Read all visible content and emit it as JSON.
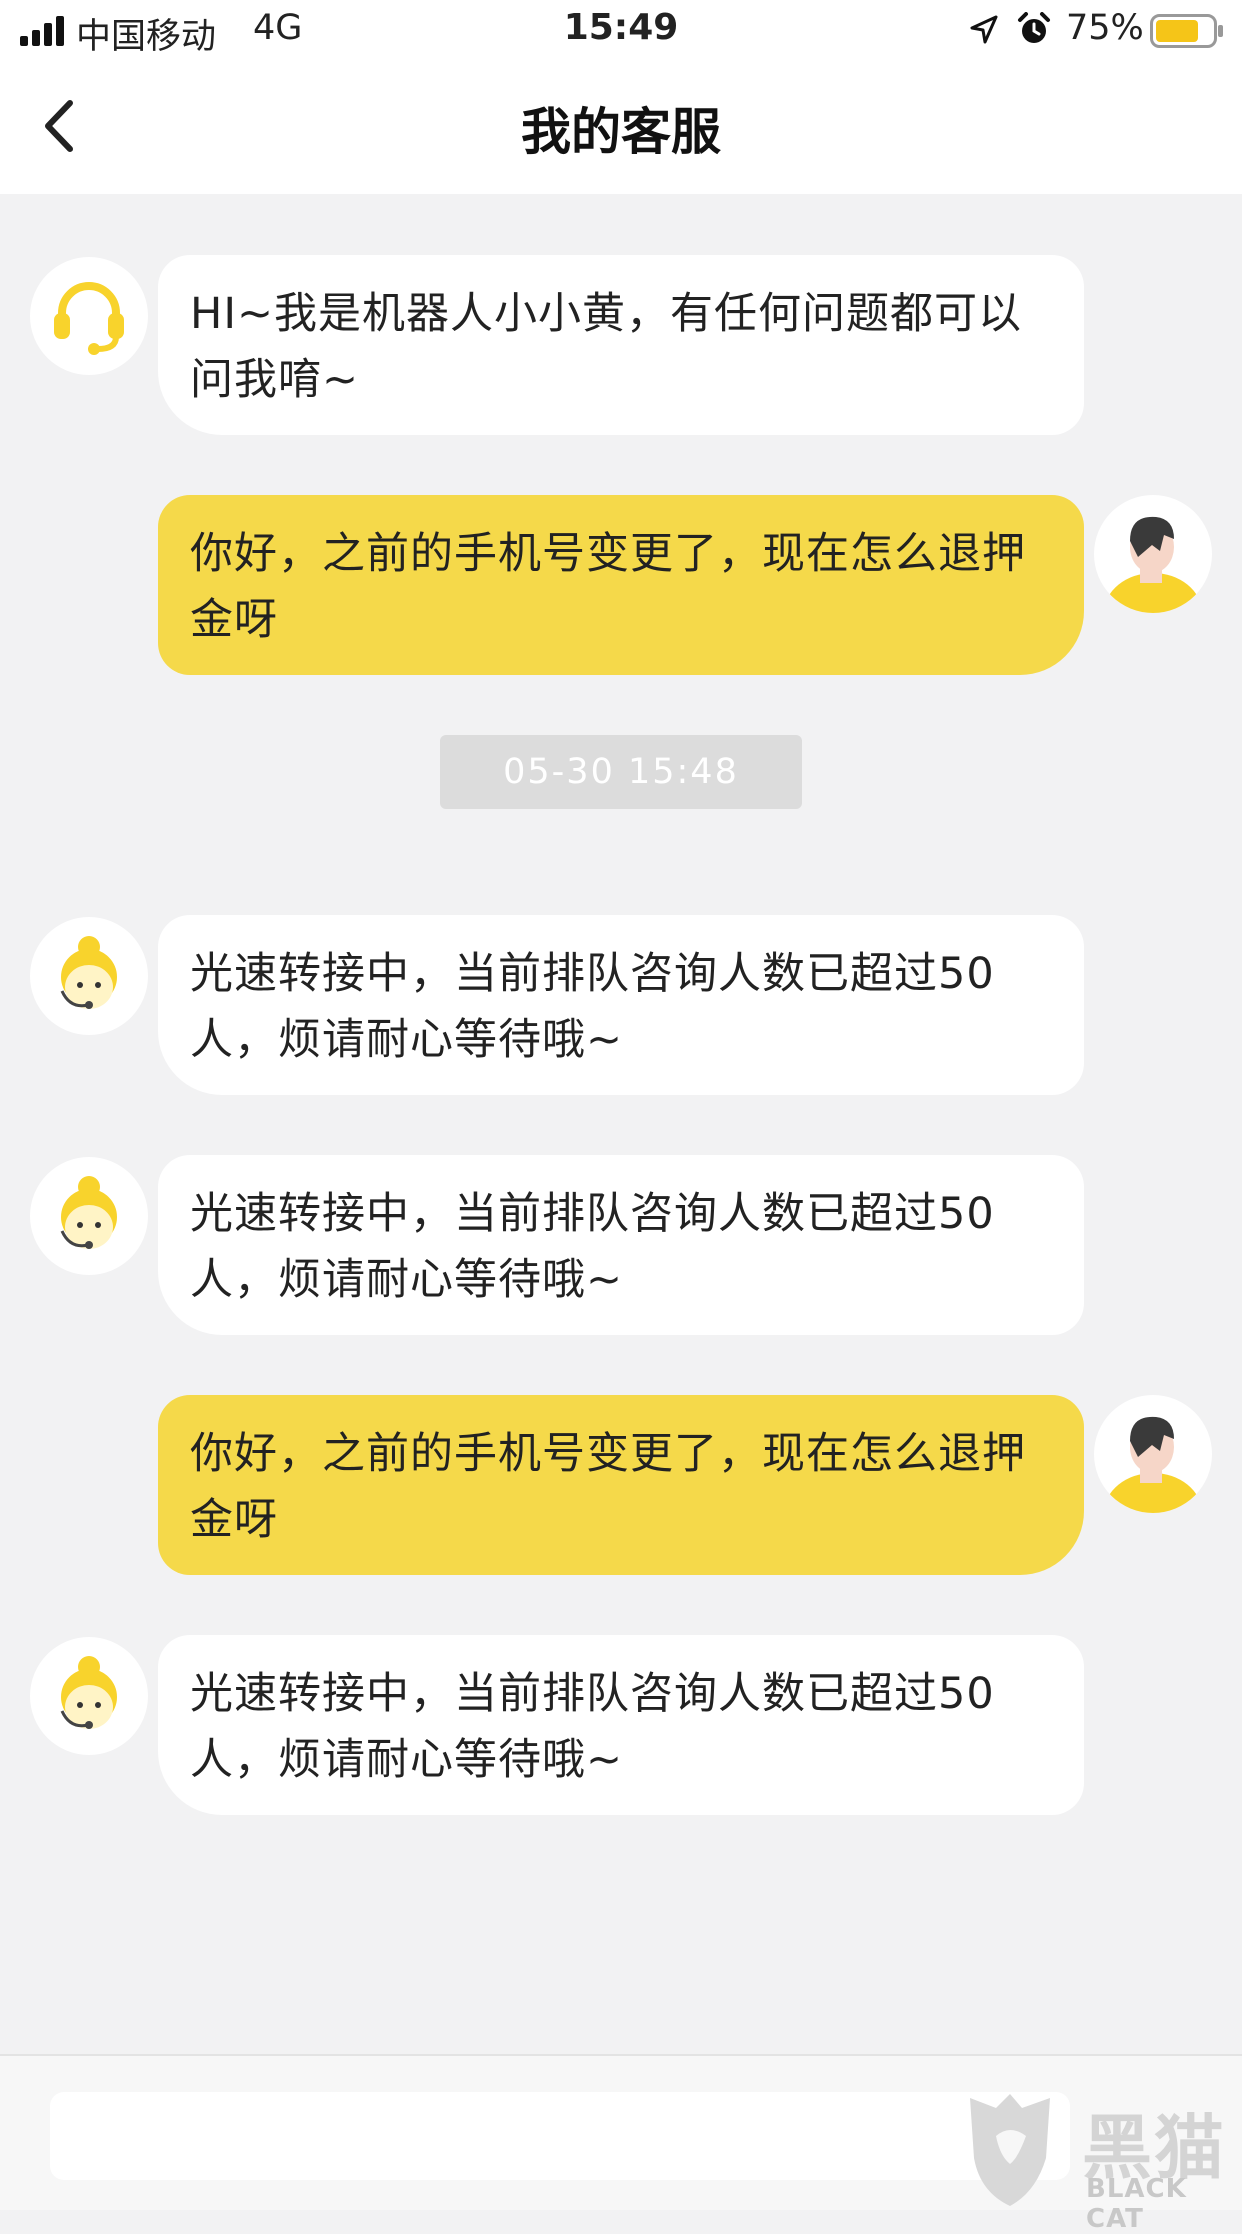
{
  "status_bar": {
    "carrier": "中国移动",
    "network": "4G",
    "time": "15:49",
    "battery": "75%",
    "battery_level": 0.75
  },
  "header": {
    "title": "我的客服"
  },
  "messages": [
    {
      "from": "bot",
      "avatar": "headset-icon",
      "text": "HI~我是机器人小小黄，有任何问题都可以问我唷~"
    },
    {
      "from": "user",
      "avatar": "user-avatar",
      "text": "你好，之前的手机号变更了，现在怎么退押金呀"
    },
    {
      "from": "system",
      "text": "05-30 15:48"
    },
    {
      "from": "agent",
      "avatar": "agent-avatar",
      "text": "光速转接中，当前排队咨询人数已超过50人，烦请耐心等待哦~"
    },
    {
      "from": "agent",
      "avatar": "agent-avatar",
      "text": "光速转接中，当前排队咨询人数已超过50人，烦请耐心等待哦~"
    },
    {
      "from": "user",
      "avatar": "user-avatar",
      "text": "你好，之前的手机号变更了，现在怎么退押金呀"
    },
    {
      "from": "agent",
      "avatar": "agent-avatar",
      "text": "光速转接中，当前排队咨询人数已超过50人，烦请耐心等待哦~"
    }
  ],
  "input": {
    "placeholder": ""
  },
  "watermark": {
    "text": "黑猫",
    "subtitle": "BLACK CAT"
  },
  "colors": {
    "accent": "#f5d94a",
    "avatar_yellow": "#f8d32c",
    "background": "#f2f2f3"
  }
}
